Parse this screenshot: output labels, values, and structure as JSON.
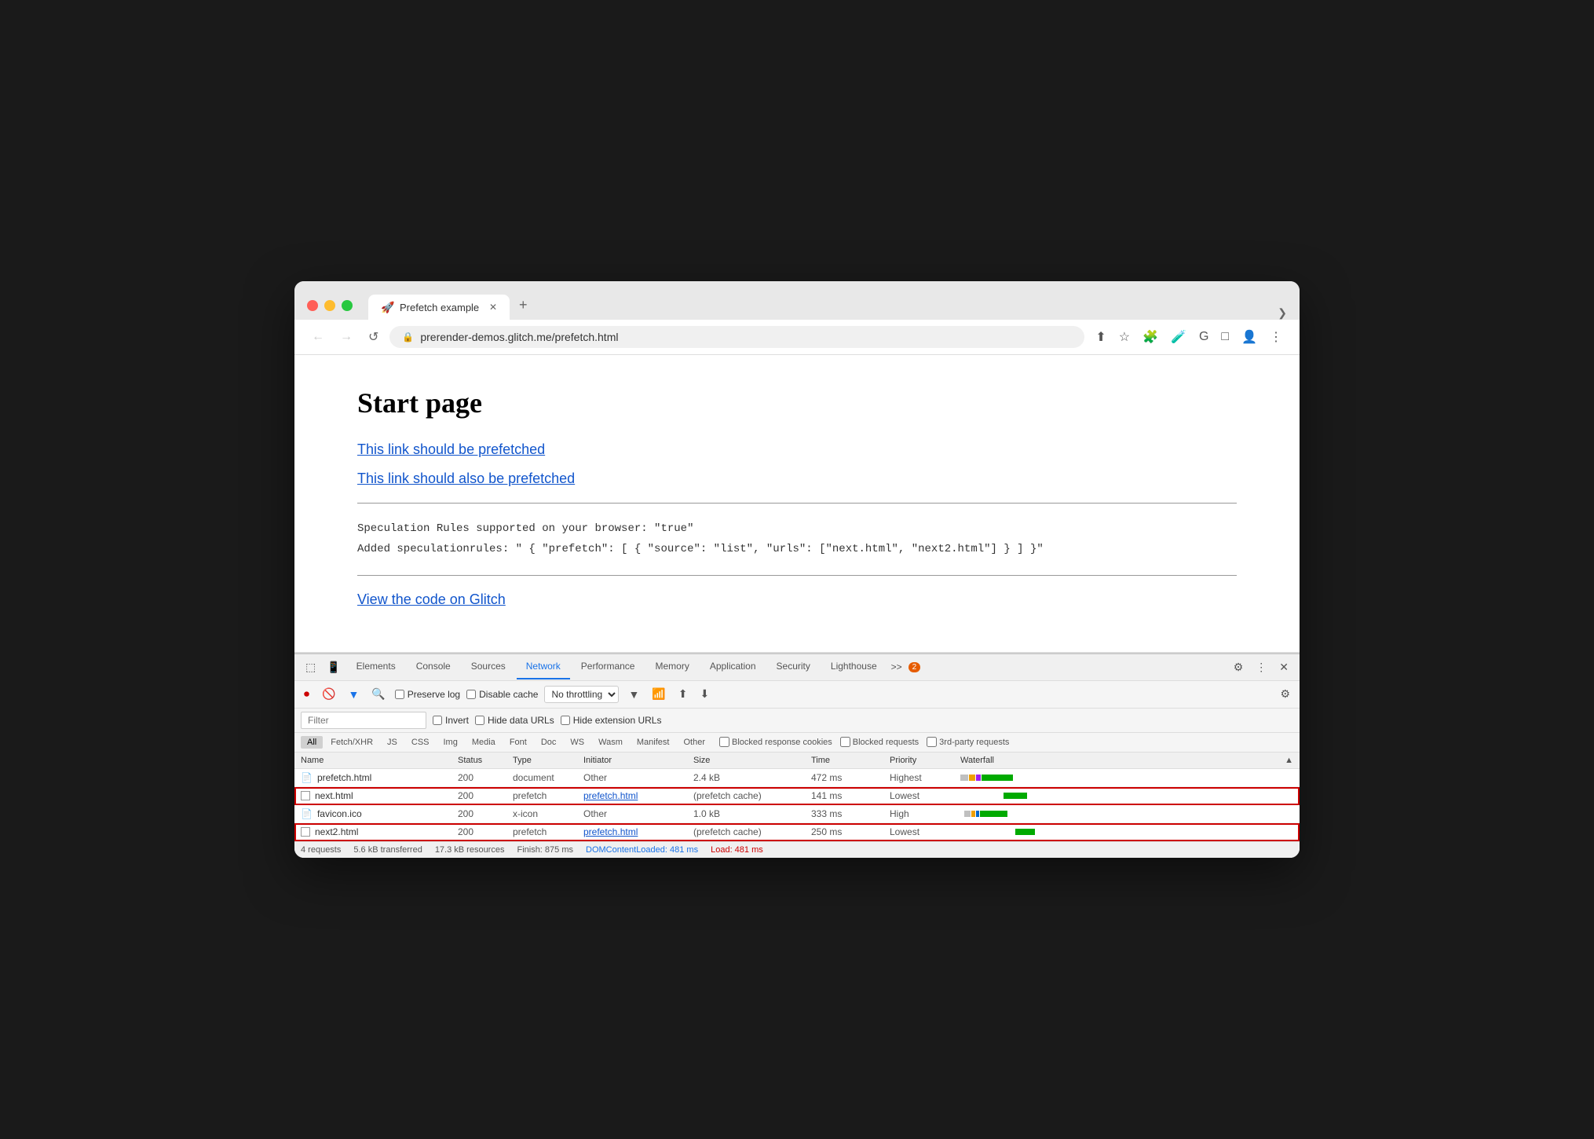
{
  "browser": {
    "tab_title": "Prefetch example",
    "tab_favicon": "🚀",
    "url": "prerender-demos.glitch.me/prefetch.html",
    "new_tab_label": "+",
    "chevron_label": "❯"
  },
  "nav": {
    "back_label": "←",
    "forward_label": "→",
    "reload_label": "↺",
    "lock_label": "🔒"
  },
  "toolbar_icons": [
    "⬆",
    "☆",
    "🧩",
    "🧪",
    "G",
    "□",
    "👤",
    "⋮"
  ],
  "page": {
    "title": "Start page",
    "link1": "This link should be prefetched",
    "link2": "This link should also be prefetched",
    "code_line1": "Speculation Rules supported on your browser: \"true\"",
    "code_line2": "Added speculationrules: \" { \"prefetch\": [ { \"source\": \"list\", \"urls\": [\"next.html\", \"next2.html\"] } ] }\"",
    "glitch_link": "View the code on Glitch"
  },
  "devtools": {
    "tabs": [
      "Elements",
      "Console",
      "Sources",
      "Network",
      "Performance",
      "Memory",
      "Application",
      "Security",
      "Lighthouse"
    ],
    "more_label": ">>",
    "badge_count": "2",
    "active_tab": "Network",
    "action_icons": [
      "⚙",
      "⋮",
      "✕"
    ]
  },
  "network_toolbar": {
    "record_icon": "⏺",
    "clear_icon": "🚫",
    "filter_icon": "▼",
    "search_icon": "🔍",
    "preserve_log_label": "Preserve log",
    "disable_cache_label": "Disable cache",
    "throttle_value": "No throttling",
    "throttle_arrow": "▼",
    "wifi_icon": "📶",
    "upload_icon": "⬆",
    "download_icon": "⬇",
    "settings_icon": "⚙"
  },
  "filter_bar": {
    "filter_placeholder": "Filter",
    "invert_label": "Invert",
    "hide_data_urls_label": "Hide data URLs",
    "hide_ext_urls_label": "Hide extension URLs"
  },
  "type_filters": {
    "types": [
      "All",
      "Fetch/XHR",
      "JS",
      "CSS",
      "Img",
      "Media",
      "Font",
      "Doc",
      "WS",
      "Wasm",
      "Manifest",
      "Other"
    ],
    "active_type": "All",
    "checkboxes": [
      "Blocked response cookies",
      "Blocked requests",
      "3rd-party requests"
    ]
  },
  "table": {
    "headers": [
      "Name",
      "Status",
      "Type",
      "Initiator",
      "Size",
      "Time",
      "Priority",
      "Waterfall"
    ],
    "rows": [
      {
        "name": "prefetch.html",
        "icon": "📄",
        "status": "200",
        "type": "document",
        "initiator": "Other",
        "initiator_link": false,
        "size": "2.4 kB",
        "time": "472 ms",
        "priority": "Highest",
        "highlighted": false,
        "waterfall_colors": [
          "#c0c0c0",
          "#f0a000",
          "#a020f0",
          "#00aa00"
        ],
        "waterfall_widths": [
          10,
          8,
          6,
          40
        ]
      },
      {
        "name": "next.html",
        "icon": "☐",
        "status": "200",
        "type": "prefetch",
        "initiator": "prefetch.html",
        "initiator_link": true,
        "size": "(prefetch cache)",
        "time": "141 ms",
        "priority": "Lowest",
        "highlighted": true,
        "waterfall_colors": [
          "#00aa00"
        ],
        "waterfall_widths": [
          30
        ]
      },
      {
        "name": "favicon.ico",
        "icon": "📄",
        "status": "200",
        "type": "x-icon",
        "initiator": "Other",
        "initiator_link": false,
        "size": "1.0 kB",
        "time": "333 ms",
        "priority": "High",
        "highlighted": false,
        "waterfall_colors": [
          "#c0c0c0",
          "#f0a000",
          "#0066cc",
          "#00aa00"
        ],
        "waterfall_widths": [
          8,
          5,
          4,
          35
        ]
      },
      {
        "name": "next2.html",
        "icon": "☐",
        "status": "200",
        "type": "prefetch",
        "initiator": "prefetch.html",
        "initiator_link": true,
        "size": "(prefetch cache)",
        "time": "250 ms",
        "priority": "Lowest",
        "highlighted": true,
        "waterfall_colors": [
          "#00aa00"
        ],
        "waterfall_widths": [
          25
        ]
      }
    ]
  },
  "status_bar": {
    "requests": "4 requests",
    "transferred": "5.6 kB transferred",
    "resources": "17.3 kB resources",
    "finish": "Finish: 875 ms",
    "dom_content_loaded": "DOMContentLoaded: 481 ms",
    "load": "Load: 481 ms"
  }
}
